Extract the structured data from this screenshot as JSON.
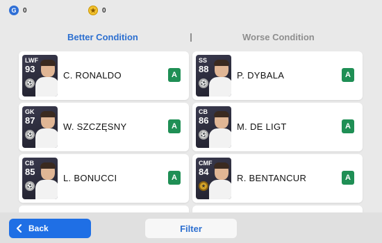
{
  "currencies": {
    "gp": {
      "icon": "gp-coin-icon",
      "value": "0"
    },
    "coins": {
      "icon": "star-coin-icon",
      "value": "0"
    }
  },
  "tabs": {
    "better": "Better Condition",
    "worse": "Worse Condition"
  },
  "players": {
    "left": [
      {
        "position": "LWF",
        "rating": "93",
        "name": "C. RONALDO",
        "condition": "A"
      },
      {
        "position": "GK",
        "rating": "87",
        "name": "W. SZCZĘSNY",
        "condition": "A"
      },
      {
        "position": "CB",
        "rating": "85",
        "name": "L. BONUCCI",
        "condition": "A"
      }
    ],
    "right": [
      {
        "position": "SS",
        "rating": "88",
        "name": "P. DYBALA",
        "condition": "A"
      },
      {
        "position": "CB",
        "rating": "86",
        "name": "M. DE LIGT",
        "condition": "A"
      },
      {
        "position": "CMF",
        "rating": "84",
        "name": "R. BENTANCUR",
        "condition": "A"
      }
    ]
  },
  "footer": {
    "back_label": "Back",
    "filter_label": "Filter"
  },
  "colors": {
    "accent": "#2c6fd0",
    "condition_A": "#1f8f55",
    "back_button": "#1f6fe5"
  }
}
